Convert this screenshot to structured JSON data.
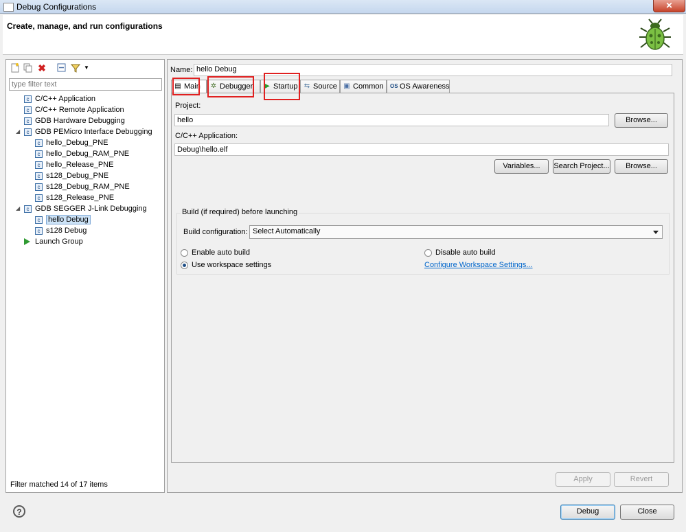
{
  "window": {
    "title": "Debug Configurations",
    "close_glyph": "✕"
  },
  "header": {
    "title": "Create, manage, and run configurations",
    "icon": "bug-icon"
  },
  "left": {
    "filter_placeholder": "type filter text",
    "tree": [
      {
        "label": "C/C++ Application"
      },
      {
        "label": "C/C++ Remote Application"
      },
      {
        "label": "GDB Hardware Debugging"
      },
      {
        "label": "GDB PEMicro Interface Debugging"
      },
      {
        "label": "hello_Debug_PNE"
      },
      {
        "label": "hello_Debug_RAM_PNE"
      },
      {
        "label": "hello_Release_PNE"
      },
      {
        "label": "s128_Debug_PNE"
      },
      {
        "label": "s128_Debug_RAM_PNE"
      },
      {
        "label": "s128_Release_PNE"
      },
      {
        "label": "GDB SEGGER J-Link Debugging"
      },
      {
        "label": "hello Debug"
      },
      {
        "label": "s128 Debug"
      },
      {
        "label": "Launch Group"
      }
    ],
    "status": "Filter matched 14 of 17 items"
  },
  "right": {
    "name_label": "Name:",
    "name_value": "hello Debug",
    "tabs": [
      {
        "label": "Main"
      },
      {
        "label": "Debugger"
      },
      {
        "label": "Startup"
      },
      {
        "label": "Source"
      },
      {
        "label": "Common"
      },
      {
        "label": "OS Awareness"
      }
    ],
    "project_label": "Project:",
    "project_value": "hello",
    "browse": "Browse...",
    "app_label": "C/C++ Application:",
    "app_value": "Debug\\hello.elf",
    "variables": "Variables...",
    "search_project": "Search Project...",
    "build_group": "Build (if required) before launching",
    "build_config_label": "Build configuration:",
    "build_config_value": "Select Automatically",
    "enable_auto": "Enable auto build",
    "disable_auto": "Disable auto build",
    "use_workspace": "Use workspace settings",
    "configure_link": "Configure Workspace Settings...",
    "apply": "Apply",
    "revert": "Revert"
  },
  "footer": {
    "help": "?",
    "debug": "Debug",
    "close": "Close"
  }
}
